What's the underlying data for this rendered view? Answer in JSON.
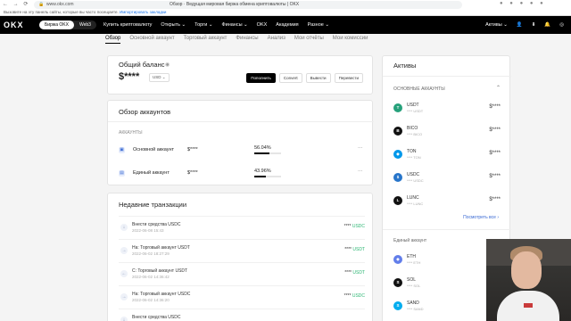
{
  "browser": {
    "url": "www.okx.com",
    "tab_title": "Обзор · Ведущая мировая биржа обмена криптовалюты | OKX",
    "bookmark_text": "Вызовите на эту панель сайты, которые вы часто посещаете.",
    "bookmark_link": "Импортировать закладки"
  },
  "navbar": {
    "logo": "OKX",
    "toggle_exchange": "Биржа OKX",
    "toggle_web3": "Web3",
    "links": [
      "Купить криптовалюту",
      "Открыть ⌄",
      "Торги ⌄",
      "Финансы ⌄",
      "OKX",
      "Академия",
      "Разное ⌄"
    ],
    "assets_label": "Активы ⌄"
  },
  "subtabs": [
    "Обзор",
    "Основной аккаунт",
    "Торговый аккаунт",
    "Финансы",
    "Анализ",
    "Мои отчёты",
    "Мои комиссии"
  ],
  "balance": {
    "title": "Общий баланс",
    "amount": "$****",
    "currency": "USD ⌄",
    "buttons": [
      "Пополнить",
      "Convert",
      "Вывести",
      "Перевести"
    ]
  },
  "overview": {
    "title": "Обзор аккаунтов",
    "section": "АККАУНТЫ",
    "rows": [
      {
        "name": "Основной аккаунт",
        "amount": "$****",
        "percent_label": "56.04%",
        "percent": 56.04
      },
      {
        "name": "Единый аккаунт",
        "amount": "$****",
        "percent_label": "43.96%",
        "percent": 43.96
      }
    ]
  },
  "transactions": {
    "title": "Недавние транзакции",
    "items": [
      {
        "title": "Внести средства USDC",
        "date": "2022-06-08 15:43",
        "amount": "**** ",
        "currency": "USDC"
      },
      {
        "title": "На: Торговый аккаунт USDT",
        "date": "2022-06-02 18:27:29",
        "amount": "**** ",
        "currency": "USDT"
      },
      {
        "title": "С: Торговый аккаунт USDT",
        "date": "2022-06-02 14:36:42",
        "amount": "**** ",
        "currency": "USDT"
      },
      {
        "title": "На: Торговый аккаунт USDC",
        "date": "2022-06-02 14:36:20",
        "amount": "**** ",
        "currency": "USDC"
      },
      {
        "title": "Внести средства USDC",
        "date": "",
        "amount": "",
        "currency": ""
      }
    ]
  },
  "assets": {
    "title": "Активы",
    "main_section": "ОСНОВНЫЕ АККАУНТЫ",
    "main_items": [
      {
        "sym": "USDT",
        "sub": "**** USDT",
        "val": "$****",
        "color": "#26a17b",
        "glyph": "T"
      },
      {
        "sym": "BICO",
        "sub": "**** BICO",
        "val": "$****",
        "color": "#111111",
        "glyph": "B"
      },
      {
        "sym": "TON",
        "sub": "**** TON",
        "val": "$****",
        "color": "#0098ea",
        "glyph": "◆"
      },
      {
        "sym": "USDC",
        "sub": "**** USDC",
        "val": "$****",
        "color": "#2775ca",
        "glyph": "$"
      },
      {
        "sym": "LUNC",
        "sub": "**** LUNC",
        "val": "$****",
        "color": "#111111",
        "glyph": "L"
      }
    ],
    "see_all": "Посмотреть все ›",
    "unified_section": "Единый аккаунт",
    "unified_items": [
      {
        "sym": "ETH",
        "sub": "**** ETH",
        "val": "$****",
        "color": "#627eea",
        "glyph": "◆"
      },
      {
        "sym": "SOL",
        "sub": "**** SOL",
        "val": "$****",
        "color": "#111111",
        "glyph": "S"
      },
      {
        "sym": "SAND",
        "sub": "**** SAND",
        "val": "$****",
        "color": "#00adef",
        "glyph": "S"
      }
    ]
  }
}
